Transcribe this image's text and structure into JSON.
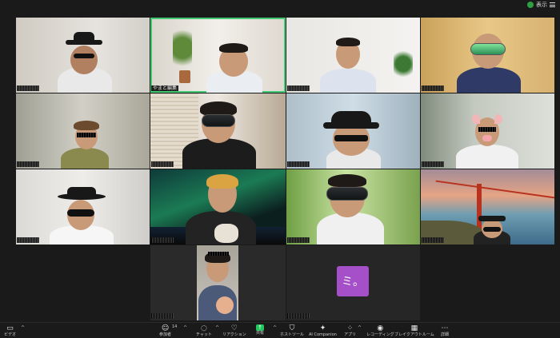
{
  "topbar": {
    "view_label": "表示"
  },
  "tiles": [
    {
      "name": "participant-1",
      "label": ""
    },
    {
      "name": "participant-2",
      "label": "やまと編集"
    },
    {
      "name": "participant-3",
      "label": ""
    },
    {
      "name": "participant-4",
      "label": ""
    },
    {
      "name": "participant-5",
      "label": ""
    },
    {
      "name": "participant-6",
      "label": ""
    },
    {
      "name": "participant-7",
      "label": ""
    },
    {
      "name": "participant-8",
      "label": ""
    },
    {
      "name": "participant-9",
      "label": ""
    },
    {
      "name": "participant-10",
      "label": ""
    },
    {
      "name": "participant-11",
      "label": ""
    },
    {
      "name": "participant-12",
      "label": ""
    },
    {
      "name": "participant-13",
      "label": ""
    },
    {
      "name": "participant-14",
      "label": ""
    }
  ],
  "app_tile": {
    "glyph": "ミ。"
  },
  "toolbar": {
    "video_label": "ビデオ",
    "participants_label": "参加者",
    "participants_count": "14",
    "chat_label": "チャット",
    "reactions_label": "リアクション",
    "share_label": "共有",
    "host_tools_label": "ホストツール",
    "ai_companion_label": "AI Companion",
    "apps_label": "アプリ",
    "record_label": "レコーディング",
    "breakout_label": "ブレイクアウトルーム",
    "more_label": "詳細"
  },
  "colors": {
    "accent_green": "#42c873",
    "share_green": "#22c55e",
    "app_purple": "#a550c9"
  }
}
